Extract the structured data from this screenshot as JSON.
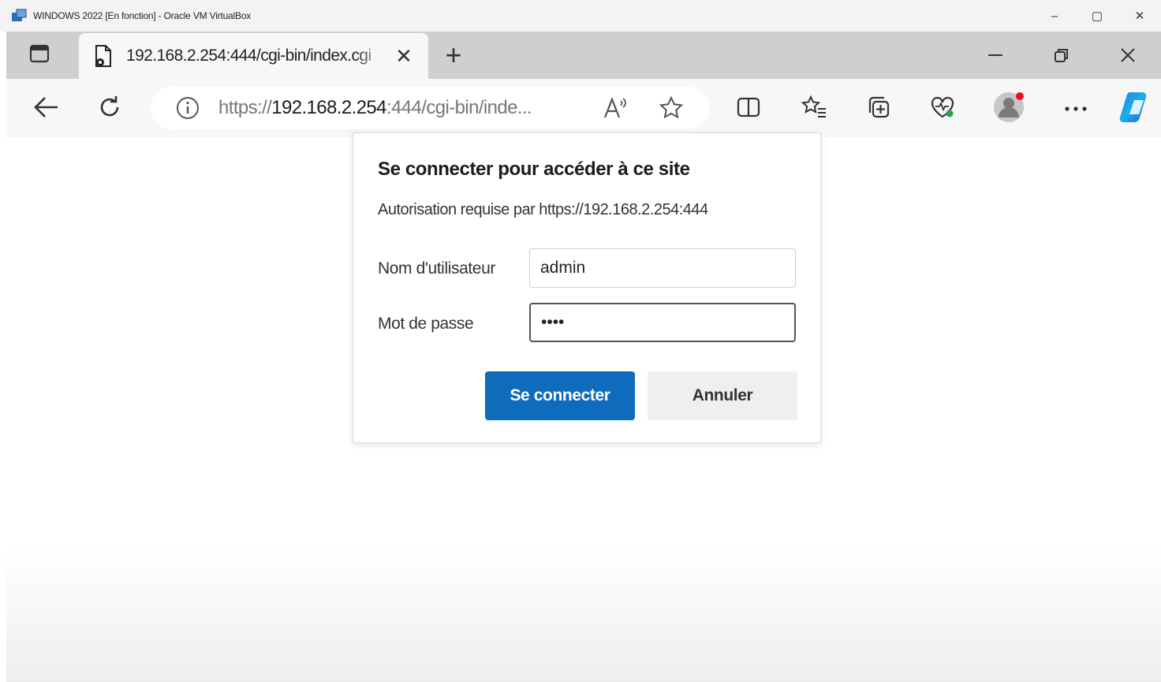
{
  "vm_window": {
    "title": "WINDOWS 2022 [En fonction] - Oracle VM VirtualBox",
    "controls": {
      "minimize": "–",
      "maximize": "▢",
      "close": "✕"
    }
  },
  "browser": {
    "tab": {
      "title": "192.168.2.254:444/cgi-bin/index.cgi",
      "close": "✕"
    },
    "new_tab": "+",
    "address_bar": {
      "scheme": "https://",
      "host": "192.168.2.254",
      "rest": ":444/cgi-bin/inde..."
    },
    "icons": [
      "tab-actions-icon",
      "page-favicon-icon",
      "back-icon",
      "refresh-icon",
      "info-icon",
      "read-aloud-icon",
      "favorite-star-icon",
      "split-screen-icon",
      "favorites-icon",
      "collections-icon",
      "browser-essentials-icon",
      "profile-icon",
      "more-icon",
      "copilot-icon"
    ],
    "profile_badge_color": "#e81123"
  },
  "auth_dialog": {
    "title": "Se connecter pour accéder à ce site",
    "subtitle": "Autorisation requise par https://192.168.2.254:444",
    "username_label": "Nom d'utilisateur",
    "username_value": "admin",
    "password_label": "Mot de passe",
    "password_value": "••••",
    "submit_label": "Se connecter",
    "cancel_label": "Annuler",
    "accent_color": "#0f6cbd"
  }
}
